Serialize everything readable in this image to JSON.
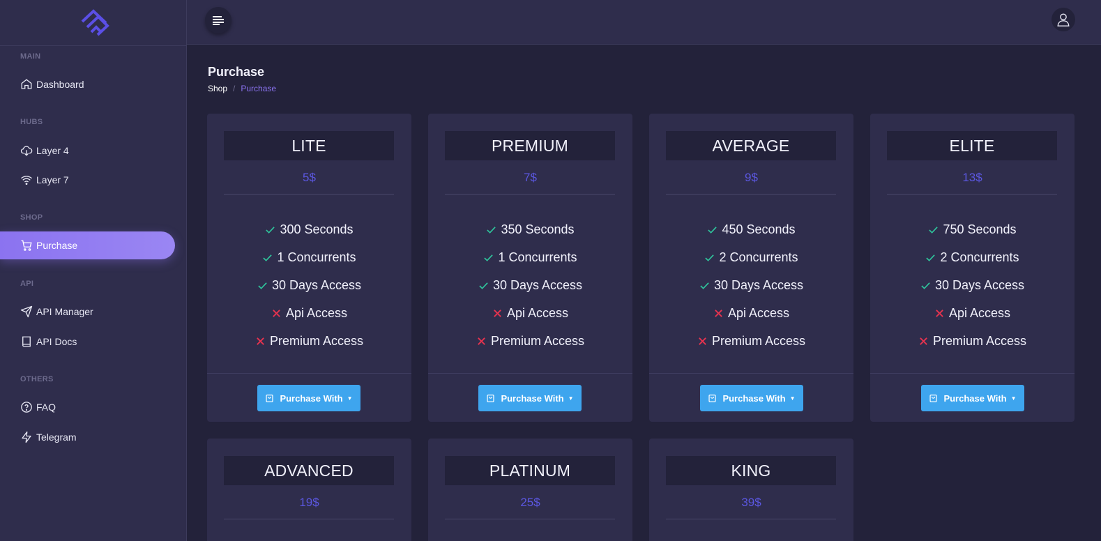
{
  "sidebar": {
    "sections": [
      {
        "label": "MAIN",
        "items": [
          {
            "label": "Dashboard",
            "icon": "home-icon"
          }
        ]
      },
      {
        "label": "HUBS",
        "items": [
          {
            "label": "Layer 4",
            "icon": "cloud-download-icon"
          },
          {
            "label": "Layer 7",
            "icon": "wifi-icon"
          }
        ]
      },
      {
        "label": "SHOP",
        "items": [
          {
            "label": "Purchase",
            "icon": "cart-icon",
            "active": true
          }
        ]
      },
      {
        "label": "API",
        "items": [
          {
            "label": "API Manager",
            "icon": "send-icon"
          },
          {
            "label": "API Docs",
            "icon": "book-icon"
          }
        ]
      },
      {
        "label": "OTHERS",
        "items": [
          {
            "label": "FAQ",
            "icon": "help-circle-icon"
          },
          {
            "label": "Telegram",
            "icon": "zap-icon"
          }
        ]
      }
    ]
  },
  "topbar": {
    "menu_icon": "menu-icon",
    "profile_icon": "user-icon"
  },
  "page": {
    "title": "Purchase",
    "breadcrumb": {
      "home": "Shop",
      "separator": "/",
      "current": "Purchase"
    }
  },
  "plans": [
    {
      "name": "LITE",
      "price": "5$",
      "features": [
        {
          "text": "300 Seconds",
          "ok": true
        },
        {
          "text": "1 Concurrents",
          "ok": true
        },
        {
          "text": "30 Days Access",
          "ok": true
        },
        {
          "text": "Api Access",
          "ok": false
        },
        {
          "text": "Premium Access",
          "ok": false
        }
      ],
      "button": "Purchase With"
    },
    {
      "name": "PREMIUM",
      "price": "7$",
      "features": [
        {
          "text": "350 Seconds",
          "ok": true
        },
        {
          "text": "1 Concurrents",
          "ok": true
        },
        {
          "text": "30 Days Access",
          "ok": true
        },
        {
          "text": "Api Access",
          "ok": false
        },
        {
          "text": "Premium Access",
          "ok": false
        }
      ],
      "button": "Purchase With"
    },
    {
      "name": "AVERAGE",
      "price": "9$",
      "features": [
        {
          "text": "450 Seconds",
          "ok": true
        },
        {
          "text": "2 Concurrents",
          "ok": true
        },
        {
          "text": "30 Days Access",
          "ok": true
        },
        {
          "text": "Api Access",
          "ok": false
        },
        {
          "text": "Premium Access",
          "ok": false
        }
      ],
      "button": "Purchase With"
    },
    {
      "name": "ELITE",
      "price": "13$",
      "features": [
        {
          "text": "750 Seconds",
          "ok": true
        },
        {
          "text": "2 Concurrents",
          "ok": true
        },
        {
          "text": "30 Days Access",
          "ok": true
        },
        {
          "text": "Api Access",
          "ok": false
        },
        {
          "text": "Premium Access",
          "ok": false
        }
      ],
      "button": "Purchase With"
    },
    {
      "name": "ADVANCED",
      "price": "19$"
    },
    {
      "name": "PLATINUM",
      "price": "25$"
    },
    {
      "name": "KING",
      "price": "39$"
    }
  ],
  "colors": {
    "check": "#2fc19a",
    "cross": "#e8334f",
    "accent": "#8b73f0",
    "price": "#5b57e0",
    "button": "#3ea5ee"
  }
}
